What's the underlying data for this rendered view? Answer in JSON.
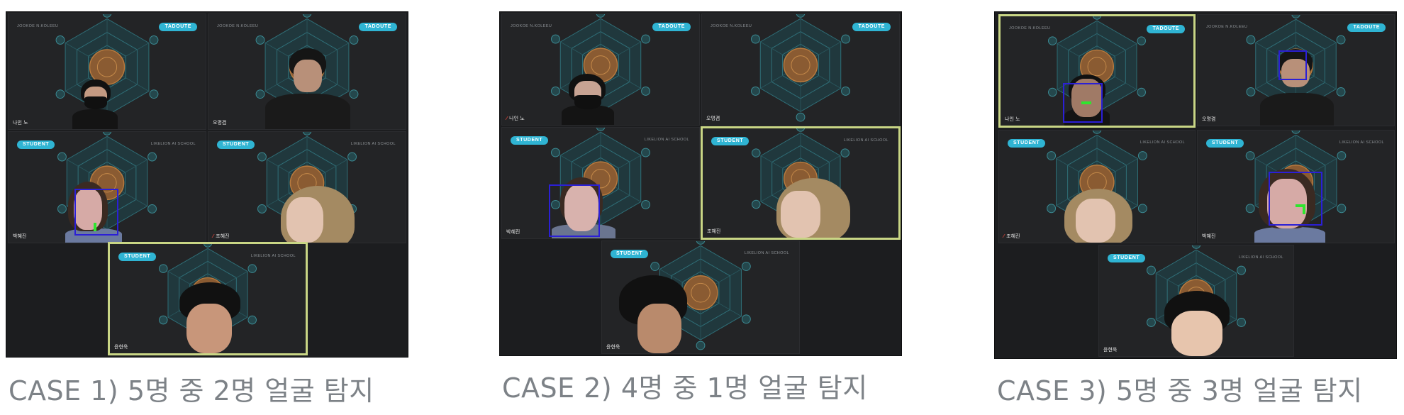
{
  "cases": [
    {
      "caption": "CASE 1) 5명 중 2명 얼굴 탐지",
      "tiles": [
        {
          "badge": "TADOUTE",
          "org": "JOOKOE N.KOLEEU",
          "name": "나인 노",
          "mic_muted": false
        },
        {
          "badge": "TADOUTE",
          "org": "JOOKOE N.KOLEEU",
          "name": "오명겸",
          "mic_muted": false
        },
        {
          "badge": "STUDENT",
          "org": "LIKELION AI SCHOOL",
          "name": "박혜진",
          "mic_muted": false
        },
        {
          "badge": "STUDENT",
          "org": "LIKELION AI SCHOOL",
          "name": "조혜진",
          "mic_muted": true
        },
        {
          "badge": "STUDENT",
          "org": "LIKELION AI SCHOOL",
          "name": "윤현욱",
          "mic_muted": false
        }
      ]
    },
    {
      "caption": "CASE 2) 4명 중 1명 얼굴 탐지",
      "tiles": [
        {
          "badge": "TADOUTE",
          "org": "JOOKOE N.KOLEEU",
          "name": "나인 노",
          "mic_muted": true
        },
        {
          "badge": "TADOUTE",
          "org": "JOOKOE N.KOLEEU",
          "name": "오명겸",
          "mic_muted": false
        },
        {
          "badge": "STUDENT",
          "org": "LIKELION AI SCHOOL",
          "name": "박혜진",
          "mic_muted": false
        },
        {
          "badge": "STUDENT",
          "org": "LIKELION AI SCHOOL",
          "name": "조혜진",
          "mic_muted": false
        },
        {
          "badge": "STUDENT",
          "org": "LIKELION AI SCHOOL",
          "name": "윤현욱",
          "mic_muted": false
        }
      ]
    },
    {
      "caption": "CASE 3) 5명 중 3명 얼굴 탐지",
      "tiles": [
        {
          "badge": "TADOUTE",
          "org": "JOOKOE N.KOLEEU",
          "name": "나인 노",
          "mic_muted": false
        },
        {
          "badge": "TADOUTE",
          "org": "JOOKOE N.KOLEEU",
          "name": "오명겸",
          "mic_muted": false
        },
        {
          "badge": "STUDENT",
          "org": "LIKELION AI SCHOOL",
          "name": "조혜진",
          "mic_muted": true
        },
        {
          "badge": "STUDENT",
          "org": "LIKELION AI SCHOOL",
          "name": "박혜진",
          "mic_muted": false
        },
        {
          "badge": "STUDENT",
          "org": "LIKELION AI SCHOOL",
          "name": "윤현욱",
          "mic_muted": false
        }
      ]
    }
  ],
  "colors": {
    "badge": "#2fb4d3",
    "active_speaker_border": "#c9d685",
    "detection_box": "#2b1fd6",
    "detection_mark": "#2ee62e",
    "muted_mic": "#e2463a",
    "caption_text": "#7d8287"
  }
}
